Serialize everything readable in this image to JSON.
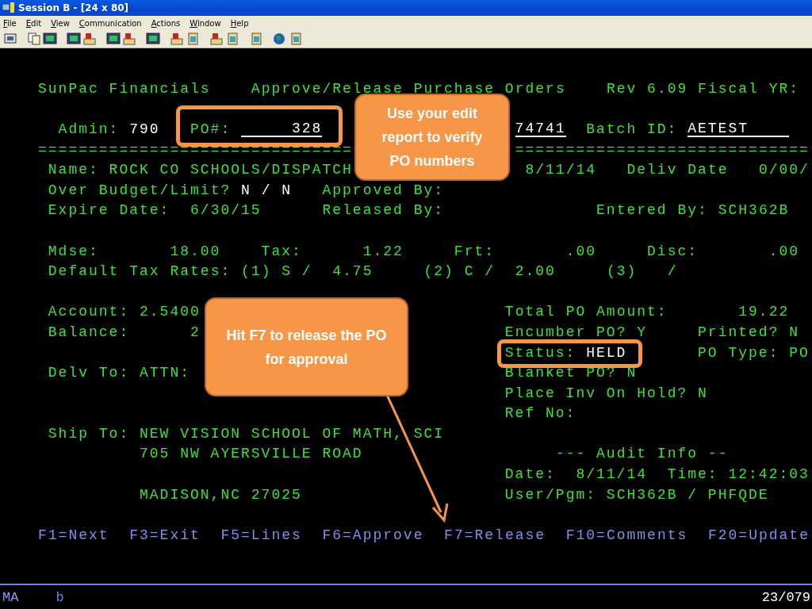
{
  "window": {
    "title": "Session B - [24 x 80]"
  },
  "menu": [
    {
      "label": "File"
    },
    {
      "label": "Edit"
    },
    {
      "label": "View"
    },
    {
      "label": "Communication"
    },
    {
      "label": "Actions"
    },
    {
      "label": "Window"
    },
    {
      "label": "Help"
    }
  ],
  "screen": {
    "lines": [
      {
        "segments": [
          {
            "text": "SunPac Financials",
            "kind": "label"
          },
          {
            "text": "Approve/Release Purchase Orders",
            "kind": "label"
          },
          {
            "text": "Rev 6.09 Fiscal YR:",
            "kind": "label"
          }
        ]
      },
      {
        "segments": [
          {
            "text": "Admin:",
            "kind": "label"
          },
          {
            "text": "790",
            "kind": "value"
          },
          {
            "text": "PO#:",
            "kind": "label"
          },
          {
            "text": "328",
            "kind": "field"
          },
          {
            "text": "74741",
            "kind": "field"
          },
          {
            "text": "Batch ID:",
            "kind": "label"
          },
          {
            "text": "AETEST",
            "kind": "field"
          }
        ]
      },
      {
        "segments": [
          {
            "text": "===============================",
            "kind": "rule"
          },
          {
            "text": "=============================",
            "kind": "rule"
          }
        ]
      },
      {
        "segments": [
          {
            "text": "Name: ROCK CO SCHOOLS/DISPATCH",
            "kind": "label"
          },
          {
            "text": "8/11/14",
            "kind": "label"
          },
          {
            "text": "Deliv Date",
            "kind": "label"
          },
          {
            "text": "0/00/",
            "kind": "label"
          }
        ]
      },
      {
        "segments": [
          {
            "text": "Over Budget/Limit?",
            "kind": "label"
          },
          {
            "text": "N / N",
            "kind": "value"
          },
          {
            "text": "Approved By:",
            "kind": "label"
          }
        ]
      },
      {
        "segments": [
          {
            "text": "Expire Date:  6/30/15",
            "kind": "label"
          },
          {
            "text": "Released By:",
            "kind": "label"
          },
          {
            "text": "Entered By: SCH362B",
            "kind": "label"
          }
        ]
      },
      {
        "segments": [
          {
            "text": "Mdse:",
            "kind": "label"
          },
          {
            "text": "18.00",
            "kind": "label"
          },
          {
            "text": "Tax:",
            "kind": "label"
          },
          {
            "text": "1.22",
            "kind": "label"
          },
          {
            "text": "Frt:",
            "kind": "label"
          },
          {
            "text": ".00",
            "kind": "label"
          },
          {
            "text": "Disc:",
            "kind": "label"
          },
          {
            "text": ".00",
            "kind": "label"
          }
        ]
      },
      {
        "segments": [
          {
            "text": "Default Tax Rates: (1) S /  4.75     (2) C /  2.00     (3)   /",
            "kind": "label"
          }
        ]
      },
      {
        "segments": [
          {
            "text": "Account: 2.5400",
            "kind": "label"
          },
          {
            "text": "Total PO Amount:",
            "kind": "label"
          },
          {
            "text": "19.22",
            "kind": "label"
          }
        ]
      },
      {
        "segments": [
          {
            "text": "Balance:",
            "kind": "label"
          },
          {
            "text": "2",
            "kind": "label"
          },
          {
            "text": "Encumber PO? Y",
            "kind": "label"
          },
          {
            "text": "Printed? N",
            "kind": "label"
          }
        ]
      },
      {
        "segments": [
          {
            "text": "Status:",
            "kind": "label"
          },
          {
            "text": "HELD",
            "kind": "value"
          },
          {
            "text": "PO Type: PO",
            "kind": "label"
          }
        ]
      },
      {
        "segments": [
          {
            "text": "Delv To: ATTN:",
            "kind": "label"
          },
          {
            "text": "Blanket PO? N",
            "kind": "label"
          }
        ]
      },
      {
        "segments": [
          {
            "text": "Place Inv On Hold? N",
            "kind": "label"
          }
        ]
      },
      {
        "segments": [
          {
            "text": "Ref No:",
            "kind": "label"
          }
        ]
      },
      {
        "segments": [
          {
            "text": "Ship To: NEW VISION SCHOOL OF MATH, SCI",
            "kind": "label"
          }
        ]
      },
      {
        "segments": [
          {
            "text": "705 NW AYERSVILLE ROAD",
            "kind": "label"
          },
          {
            "text": "--- Audit Info --",
            "kind": "label"
          }
        ]
      },
      {
        "segments": [
          {
            "text": "Date:  8/11/14  Time: 12:42:03",
            "kind": "label"
          }
        ]
      },
      {
        "segments": [
          {
            "text": "MADISON,NC 27025",
            "kind": "label"
          },
          {
            "text": "User/Pgm: SCH362B / PHFQDE",
            "kind": "label"
          }
        ]
      },
      {
        "segments": [
          {
            "text": "F1=Next",
            "kind": "key"
          },
          {
            "text": "F3=Exit",
            "kind": "key"
          },
          {
            "text": "F5=Lines",
            "kind": "key"
          },
          {
            "text": "F6=Approve",
            "kind": "key"
          },
          {
            "text": "F7=Release",
            "kind": "key"
          },
          {
            "text": "F10=Comments",
            "kind": "key"
          },
          {
            "text": "F20=Update",
            "kind": "key"
          }
        ]
      }
    ]
  },
  "callouts": [
    {
      "text": "Use your edit report to verify PO numbers"
    },
    {
      "text": "Hit F7 to release the PO for approval"
    }
  ],
  "status_bar": {
    "mode": "MA",
    "input": "b",
    "position": "23/079"
  }
}
